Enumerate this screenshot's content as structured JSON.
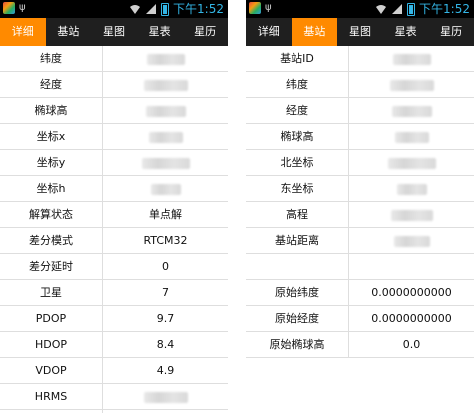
{
  "status_bar": {
    "time": "下午1:52",
    "battery_color": "#33b5e5"
  },
  "colors": {
    "tab_active": "#ff8a00",
    "tab_bar": "#1f1f1f"
  },
  "left": {
    "tabs": [
      "详细",
      "基站",
      "星图",
      "星表",
      "星历"
    ],
    "active_tab": 0,
    "rows": [
      {
        "label": "纬度",
        "value": "",
        "redacted": true
      },
      {
        "label": "经度",
        "value": "",
        "redacted": true
      },
      {
        "label": "椭球高",
        "value": "",
        "redacted": true
      },
      {
        "label": "坐标x",
        "value": "",
        "redacted": true
      },
      {
        "label": "坐标y",
        "value": "",
        "redacted": true
      },
      {
        "label": "坐标h",
        "value": "",
        "redacted": true
      },
      {
        "label": "解算状态",
        "value": "单点解"
      },
      {
        "label": "差分模式",
        "value": "RTCM32"
      },
      {
        "label": "差分延时",
        "value": "0"
      },
      {
        "label": "卫星",
        "value": "7"
      },
      {
        "label": "PDOP",
        "value": "9.7"
      },
      {
        "label": "HDOP",
        "value": "8.4"
      },
      {
        "label": "VDOP",
        "value": "4.9"
      },
      {
        "label": "HRMS",
        "value": "",
        "redacted": true
      }
    ]
  },
  "right": {
    "tabs": [
      "详细",
      "基站",
      "星图",
      "星表",
      "星历"
    ],
    "active_tab": 1,
    "rows": [
      {
        "label": "基站ID",
        "value": "",
        "redacted": true
      },
      {
        "label": "纬度",
        "value": "",
        "redacted": true
      },
      {
        "label": "经度",
        "value": "",
        "redacted": true
      },
      {
        "label": "椭球高",
        "value": "",
        "redacted": true
      },
      {
        "label": "北坐标",
        "value": "",
        "redacted": true
      },
      {
        "label": "东坐标",
        "value": "",
        "redacted": true
      },
      {
        "label": "高程",
        "value": "",
        "redacted": true
      },
      {
        "label": "基站距离",
        "value": "",
        "redacted": true
      },
      {
        "label": "",
        "value": ""
      },
      {
        "label": "原始纬度",
        "value": "0.0000000000"
      },
      {
        "label": "原始经度",
        "value": "0.0000000000"
      },
      {
        "label": "原始椭球高",
        "value": "0.0"
      }
    ]
  }
}
